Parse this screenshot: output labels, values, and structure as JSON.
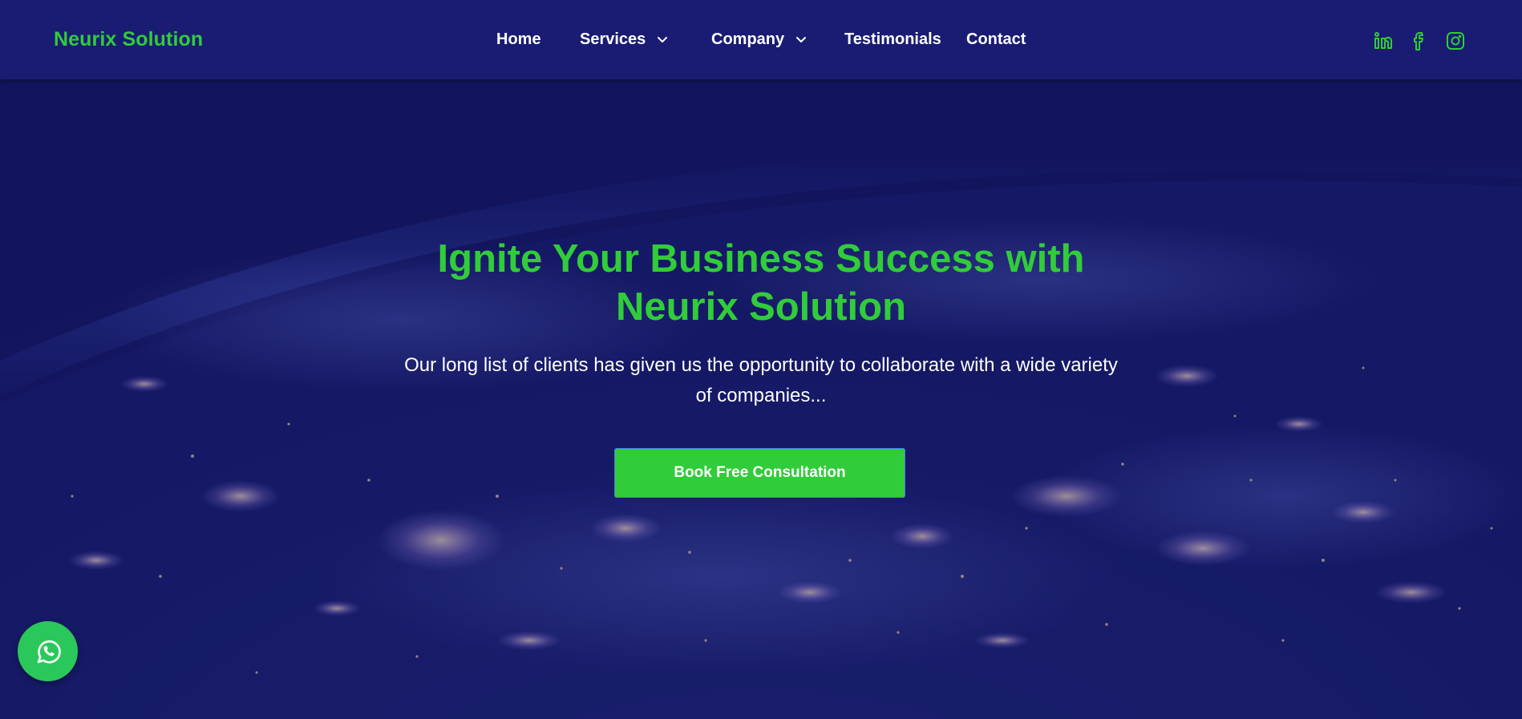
{
  "brand": {
    "name": "Neurix Solution",
    "color": "#31cc3a"
  },
  "nav": {
    "items": [
      {
        "label": "Home",
        "has_dropdown": false
      },
      {
        "label": "Services",
        "has_dropdown": true
      },
      {
        "label": "Company",
        "has_dropdown": true
      },
      {
        "label": "Testimonials",
        "has_dropdown": false
      },
      {
        "label": "Contact",
        "has_dropdown": false
      }
    ],
    "socials": [
      "linkedin-icon",
      "facebook-icon",
      "instagram-icon"
    ]
  },
  "hero": {
    "title_line1": "Ignite Your Business Success with",
    "title_line2": "Neurix Solution",
    "subtitle_line1": "Our long list of clients has given us the opportunity to collaborate with a wide variety",
    "subtitle_line2": "of companies...",
    "cta_label": "Book Free Consultation"
  },
  "floating": {
    "icon": "whatsapp-icon"
  },
  "colors": {
    "nav_bg": "#1a1c74",
    "hero_bg": "#141660",
    "accent_green": "#31cc3a",
    "whatsapp_green": "#2ac85a"
  }
}
